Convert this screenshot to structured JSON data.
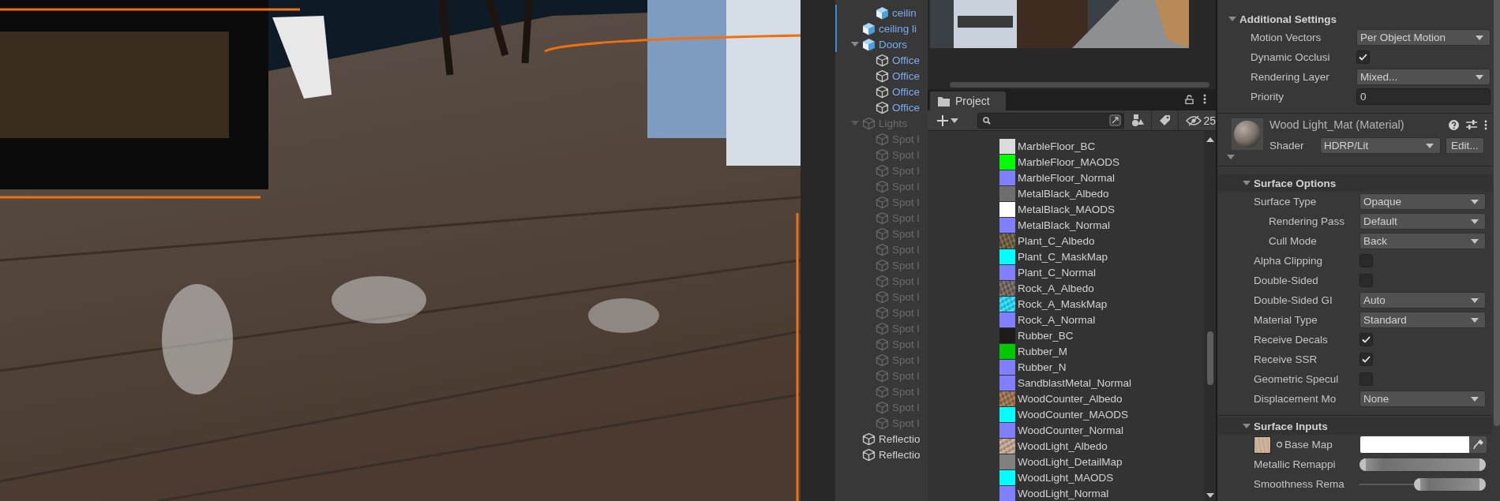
{
  "hierarchy": {
    "items": [
      {
        "children": [
          {
            "label": "ceilin",
            "kind": "prefab",
            "overridden": true,
            "disabled": false
          }
        ]
      },
      {
        "label": "ceiling li",
        "kind": "prefab",
        "overridden": true,
        "disabled": false
      },
      {
        "label": "Doors",
        "kind": "prefab",
        "overridden": true,
        "disabled": false,
        "expanded": true,
        "children": [
          {
            "label": "Office",
            "kind": "prefab_child",
            "overridden": false,
            "disabled": false
          },
          {
            "label": "Office",
            "kind": "prefab_child",
            "overridden": false,
            "disabled": false
          },
          {
            "label": "Office",
            "kind": "prefab_child",
            "overridden": false,
            "disabled": false
          },
          {
            "label": "Office",
            "kind": "prefab_child",
            "overridden": false,
            "disabled": false
          }
        ]
      },
      {
        "label": "Lights",
        "kind": "object",
        "overridden": false,
        "disabled": true,
        "expanded": true,
        "children": [
          {
            "label": "Spot l",
            "kind": "object",
            "overridden": false,
            "disabled": true
          },
          {
            "label": "Spot l",
            "kind": "object",
            "overridden": false,
            "disabled": true
          },
          {
            "label": "Spot l",
            "kind": "object",
            "overridden": false,
            "disabled": true
          },
          {
            "label": "Spot l",
            "kind": "object",
            "overridden": false,
            "disabled": true
          },
          {
            "label": "Spot l",
            "kind": "object",
            "overridden": false,
            "disabled": true
          },
          {
            "label": "Spot l",
            "kind": "object",
            "overridden": false,
            "disabled": true
          },
          {
            "label": "Spot l",
            "kind": "object",
            "overridden": false,
            "disabled": true
          },
          {
            "label": "Spot l",
            "kind": "object",
            "overridden": false,
            "disabled": true
          },
          {
            "label": "Spot l",
            "kind": "object",
            "overridden": false,
            "disabled": true
          },
          {
            "label": "Spot l",
            "kind": "object",
            "overridden": false,
            "disabled": true
          },
          {
            "label": "Spot l",
            "kind": "object",
            "overridden": false,
            "disabled": true
          },
          {
            "label": "Spot l",
            "kind": "object",
            "overridden": false,
            "disabled": true
          },
          {
            "label": "Spot l",
            "kind": "object",
            "overridden": false,
            "disabled": true
          },
          {
            "label": "Spot l",
            "kind": "object",
            "overridden": false,
            "disabled": true
          },
          {
            "label": "Spot l",
            "kind": "object",
            "overridden": false,
            "disabled": true
          },
          {
            "label": "Spot l",
            "kind": "object",
            "overridden": false,
            "disabled": true
          },
          {
            "label": "Spot l",
            "kind": "object",
            "overridden": false,
            "disabled": true
          },
          {
            "label": "Spot l",
            "kind": "object",
            "overridden": false,
            "disabled": true
          },
          {
            "label": "Spot l",
            "kind": "object",
            "overridden": false,
            "disabled": true
          }
        ]
      },
      {
        "label": "Reflectio",
        "kind": "object",
        "overridden": false,
        "disabled": false
      },
      {
        "label": "Reflectio",
        "kind": "object",
        "overridden": false,
        "disabled": false
      }
    ]
  },
  "project": {
    "tab": {
      "label": "Project",
      "selected": true
    },
    "hidden_count": "25",
    "items": [
      {
        "label": "MarbleFloor_BC",
        "kind": "swatch",
        "color": "#dcdcdc"
      },
      {
        "label": "MarbleFloor_MAODS",
        "kind": "swatch",
        "color": "#00ff00"
      },
      {
        "label": "MarbleFloor_Normal",
        "kind": "swatch",
        "color": "#8080ff"
      },
      {
        "label": "MetalBlack_Albedo",
        "kind": "swatch",
        "color": "#6e6e6e"
      },
      {
        "label": "MetalBlack_MAODS",
        "kind": "swatch",
        "color": "#ffffff"
      },
      {
        "label": "MetalBlack_Normal",
        "kind": "swatch",
        "color": "#8080ff"
      },
      {
        "label": "Plant_C_Albedo",
        "kind": "texture",
        "color": "#6b5a3a"
      },
      {
        "label": "Plant_C_MaskMap",
        "kind": "swatch",
        "color": "#00ffff"
      },
      {
        "label": "Plant_C_Normal",
        "kind": "swatch",
        "color": "#8080ff"
      },
      {
        "label": "Rock_A_Albedo",
        "kind": "texture",
        "color": "#6f6358"
      },
      {
        "label": "Rock_A_MaskMap",
        "kind": "texture",
        "color": "#22ddff"
      },
      {
        "label": "Rock_A_Normal",
        "kind": "swatch",
        "color": "#8080ff"
      },
      {
        "label": "Rubber_BC",
        "kind": "swatch",
        "color": "#1e1a18"
      },
      {
        "label": "Rubber_M",
        "kind": "swatch",
        "color": "#00c800"
      },
      {
        "label": "Rubber_N",
        "kind": "swatch",
        "color": "#8080ff"
      },
      {
        "label": "SandblastMetal_Normal",
        "kind": "swatch",
        "color": "#8080ff"
      },
      {
        "label": "WoodCounter_Albedo",
        "kind": "texture",
        "color": "#9c7048"
      },
      {
        "label": "WoodCounter_MAODS",
        "kind": "swatch",
        "color": "#00ffff"
      },
      {
        "label": "WoodCounter_Normal",
        "kind": "swatch",
        "color": "#8080ff"
      },
      {
        "label": "WoodLight_Albedo",
        "kind": "texture",
        "color": "#c6aa90"
      },
      {
        "label": "WoodLight_DetailMap",
        "kind": "swatch",
        "color": "#808080"
      },
      {
        "label": "WoodLight_MAODS",
        "kind": "swatch",
        "color": "#00ffff"
      },
      {
        "label": "WoodLight_Normal",
        "kind": "swatch",
        "color": "#8080ff"
      }
    ]
  },
  "inspector": {
    "additional_settings": {
      "title": "Additional Settings",
      "expanded": true,
      "rows": [
        {
          "label": "Motion Vectors",
          "kind": "dropdown",
          "value": "Per Object Motion"
        },
        {
          "label": "Dynamic Occlusi",
          "kind": "checkbox",
          "checked": true
        },
        {
          "label": "Rendering Layer",
          "kind": "dropdown",
          "value": "Mixed..."
        },
        {
          "label": "Priority",
          "kind": "number",
          "value": "0"
        }
      ]
    },
    "material": {
      "title": "Wood Light_Mat (Material)",
      "shader_label": "Shader",
      "shader": "HDRP/Lit",
      "edit_button": "Edit...",
      "expanded": true
    },
    "sections": [
      {
        "title": "Surface Options",
        "expanded": true,
        "rows": [
          {
            "label": "Surface Type",
            "kind": "dropdown",
            "value": "Opaque",
            "children": [
              {
                "label": "Rendering Pass",
                "kind": "dropdown",
                "value": "Default"
              },
              {
                "label": "Cull Mode",
                "kind": "dropdown",
                "value": "Back"
              }
            ]
          },
          {
            "label": "Alpha Clipping",
            "kind": "checkbox",
            "checked": false
          },
          {
            "label": "Double-Sided",
            "kind": "checkbox",
            "checked": false
          },
          {
            "label": "Double-Sided GI",
            "kind": "dropdown",
            "value": "Auto"
          },
          {
            "label": "Material Type",
            "kind": "dropdown",
            "value": "Standard"
          },
          {
            "label": "Receive Decals",
            "kind": "checkbox",
            "checked": true
          },
          {
            "label": "Receive SSR",
            "kind": "checkbox",
            "checked": true
          },
          {
            "label": "Geometric Specul",
            "kind": "checkbox",
            "checked": false
          },
          {
            "label": "Displacement Mo",
            "kind": "dropdown",
            "value": "None"
          }
        ]
      },
      {
        "title": "Surface Inputs",
        "expanded": true,
        "rows": [
          {
            "label": "Base Map",
            "kind": "texture"
          },
          {
            "label": "Metallic Remappi",
            "kind": "range",
            "min": {
              "level": 0
            },
            "max": {
              "level": 1
            }
          },
          {
            "label": "Smoothness Rema",
            "kind": "range",
            "min": {
              "level": 0.43
            },
            "max": {
              "level": 1
            }
          }
        ]
      }
    ]
  }
}
